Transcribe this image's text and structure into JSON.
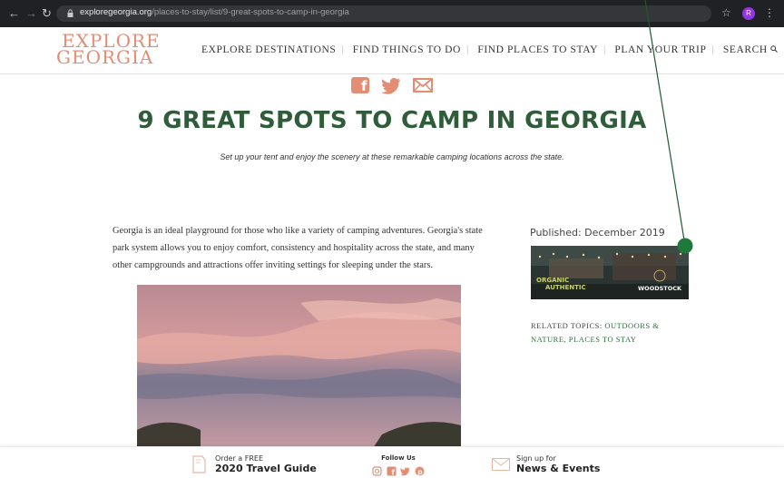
{
  "browser": {
    "url_domain": "exploregeorgia.org",
    "url_path": "/places-to-stay/list/9-great-spots-to-camp-in-georgia",
    "avatar_letter": "R",
    "icons": [
      "back-arrow-icon",
      "forward-arrow-icon",
      "reload-icon",
      "lock-icon",
      "star-icon",
      "kebab-menu-icon"
    ]
  },
  "header": {
    "logo_line1": "EXPLORE",
    "logo_line2": "GEORGIA",
    "nav": [
      "EXPLORE DESTINATIONS",
      "FIND THINGS TO DO",
      "FIND PLACES TO STAY",
      "PLAN YOUR TRIP",
      "SEARCH"
    ],
    "search_icon": "magnifier-icon"
  },
  "share": {
    "icons": [
      "facebook-icon",
      "twitter-icon",
      "email-icon"
    ],
    "color": "#e38d75"
  },
  "article": {
    "title": "9 GREAT SPOTS TO CAMP IN GEORGIA",
    "subtitle": "Set up your tent and enjoy the scenery at these remarkable camping locations across the state.",
    "paragraph": "Georgia is an ideal playground for those who like a variety of camping adventures. Georgia's state park system allows you to enjoy comfort, consistency and hospitality across the state, and many other campgrounds and attractions offer inviting settings for sleeping under the stars."
  },
  "sidebar": {
    "published": "Published: December 2019",
    "ad_text1": "ORGANIC",
    "ad_text2": "AUTHENTIC",
    "ad_brand": "WOODSTOCK",
    "related_label": "RELATED TOPICS:",
    "related_links": [
      "OUTDOORS & NATURE",
      "PLACES TO STAY"
    ]
  },
  "footer": {
    "guide_small": "Order a FREE",
    "guide_big": "2020 Travel Guide",
    "follow": "Follow Us",
    "social_icons": [
      "instagram-icon",
      "facebook-icon",
      "twitter-icon",
      "pinterest-icon"
    ],
    "signup_small": "Sign up for",
    "signup_big": "News & Events"
  },
  "colors": {
    "brand_green": "#2f5c39",
    "brand_salmon": "#e38d75",
    "annotation": "#1e7a3a"
  }
}
